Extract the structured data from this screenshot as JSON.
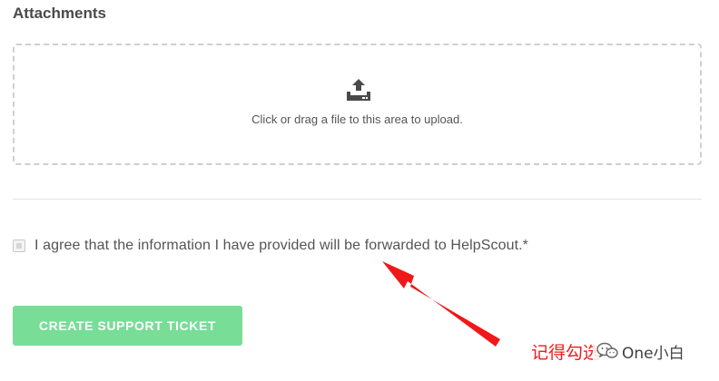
{
  "attachments": {
    "title": "Attachments",
    "dropzone_text": "Click or drag a file to this area to upload.",
    "icon": "upload-icon"
  },
  "agreement": {
    "label": "I agree that the information I have provided will be forwarded to HelpScout.*",
    "checked": false
  },
  "submit": {
    "label": "CREATE SUPPORT TICKET",
    "color": "#77dd97"
  },
  "annotation": {
    "text": "记得勾选",
    "color": "#ee1c1c"
  },
  "watermark": {
    "icon": "wechat-icon",
    "text": "One小白"
  }
}
